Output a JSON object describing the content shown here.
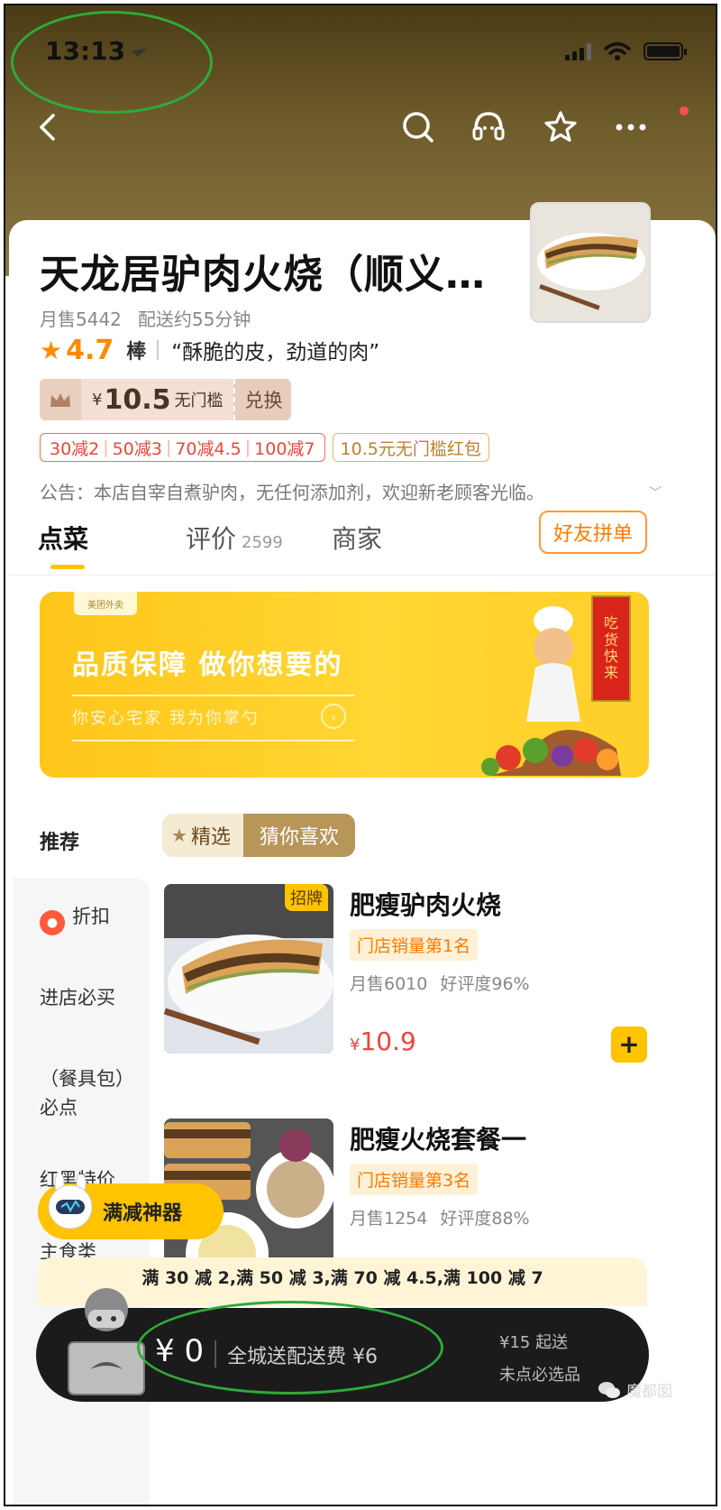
{
  "status_bar": {
    "time": "13:13"
  },
  "shop": {
    "name": "天龙居驴肉火烧（顺义…",
    "monthly_sales": "月售5442",
    "delivery_time": "配送约55分钟",
    "rating": "4.7",
    "rating_word": "棒",
    "quote": "“酥脆的皮，劲道的肉”"
  },
  "coupon": {
    "currency": "¥",
    "amount": "10.5",
    "condition": "无门槛",
    "action": "兑换"
  },
  "discount_tags": [
    "30减2",
    "50减3",
    "70减4.5",
    "100减7"
  ],
  "red_packet": "10.5元无门槛红包",
  "notice": "公告：本店自宰自煮驴肉，无任何添加剂，欢迎新老顾客光临。",
  "tabs": {
    "order": "点菜",
    "reviews": "评价",
    "reviews_count": "2599",
    "merchant": "商家",
    "group_order": "好友拼单"
  },
  "banner": {
    "logo": "美团外卖",
    "title": "品质保障 做你想要的",
    "subtitle": "你安心宅家 我为你掌勺",
    "scroll_text": [
      "吃",
      "货",
      "快",
      "来"
    ]
  },
  "recommend": {
    "label": "推荐",
    "seg_selected": "精选",
    "seg_other": "猜你喜欢"
  },
  "sidebar": {
    "items": [
      {
        "label": "折扣",
        "icon": "discount-icon"
      },
      {
        "label": "进店必买"
      },
      {
        "label": "（餐具包）必点"
      },
      {
        "label": "红黑特价"
      },
      {
        "label": "主食类"
      }
    ]
  },
  "products": [
    {
      "badge": "招牌",
      "name": "肥瘦驴肉火烧",
      "rank": "门店销量第1名",
      "sales": "月售6010",
      "rating": "好评度96%",
      "currency": "¥",
      "price": "10.9"
    },
    {
      "name": "肥瘦火烧套餐一",
      "rank": "门店销量第3名",
      "sales": "月售1254",
      "rating": "好评度88%"
    }
  ],
  "promo_float": "满减神器",
  "promo_bar": "满 30 减 2,满 50 减 3,满 70 减 4.5,满 100 减 7",
  "cart": {
    "price": "¥ 0",
    "delivery": "全城送配送费 ¥6",
    "min_order": "¥15 起送",
    "must_select": "未点必选品"
  },
  "watermark": "魔都囡",
  "colors": {
    "accent": "#ffc300",
    "price_red": "#f0443a",
    "orange": "#ff7a00",
    "annotation_green": "#2faa3a"
  }
}
